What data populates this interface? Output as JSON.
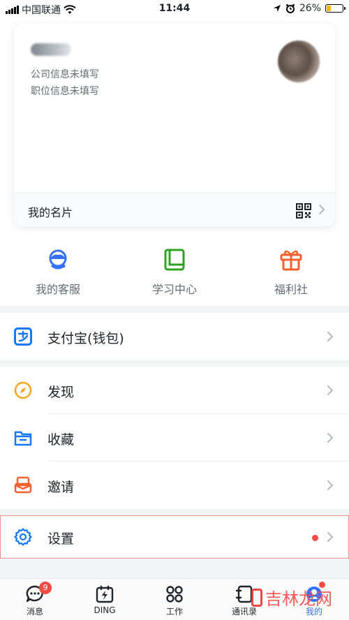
{
  "status_bar": {
    "carrier": "中国联通",
    "time": "11:44",
    "battery": "26%",
    "battery_level": 0.26
  },
  "profile_card": {
    "company": "公司信息未填写",
    "position": "职位信息未填写",
    "footer_label": "我的名片",
    "qr_icon": "qr-code-icon"
  },
  "shortcuts": [
    {
      "label": "我的客服",
      "icon": "customer-service-icon",
      "color": "#3370ff"
    },
    {
      "label": "学习中心",
      "icon": "book-icon",
      "color": "#2ea121"
    },
    {
      "label": "福利社",
      "icon": "gift-icon",
      "color": "#f0622d"
    }
  ],
  "menu": {
    "alipay": {
      "label": "支付宝(钱包)",
      "icon": "alipay-icon",
      "color": "#1677ff"
    },
    "discover": {
      "label": "发现",
      "icon": "compass-icon",
      "color": "#f5a623"
    },
    "favorites": {
      "label": "收藏",
      "icon": "folder-icon",
      "color": "#1677ff"
    },
    "invite": {
      "label": "邀请",
      "icon": "invite-icon",
      "color": "#f0622d"
    },
    "settings": {
      "label": "设置",
      "icon": "gear-icon",
      "color": "#1677ff",
      "has_dot": true
    }
  },
  "tabbar": {
    "tabs": [
      {
        "label": "消息",
        "icon": "chat-icon",
        "badge": "9"
      },
      {
        "label": "DING",
        "icon": "ding-icon"
      },
      {
        "label": "工作",
        "icon": "apps-grid-icon"
      },
      {
        "label": "通讯录",
        "icon": "contacts-icon"
      },
      {
        "label": "我的",
        "icon": "me-icon",
        "active": true
      }
    ]
  },
  "watermark": "吉林龙网"
}
